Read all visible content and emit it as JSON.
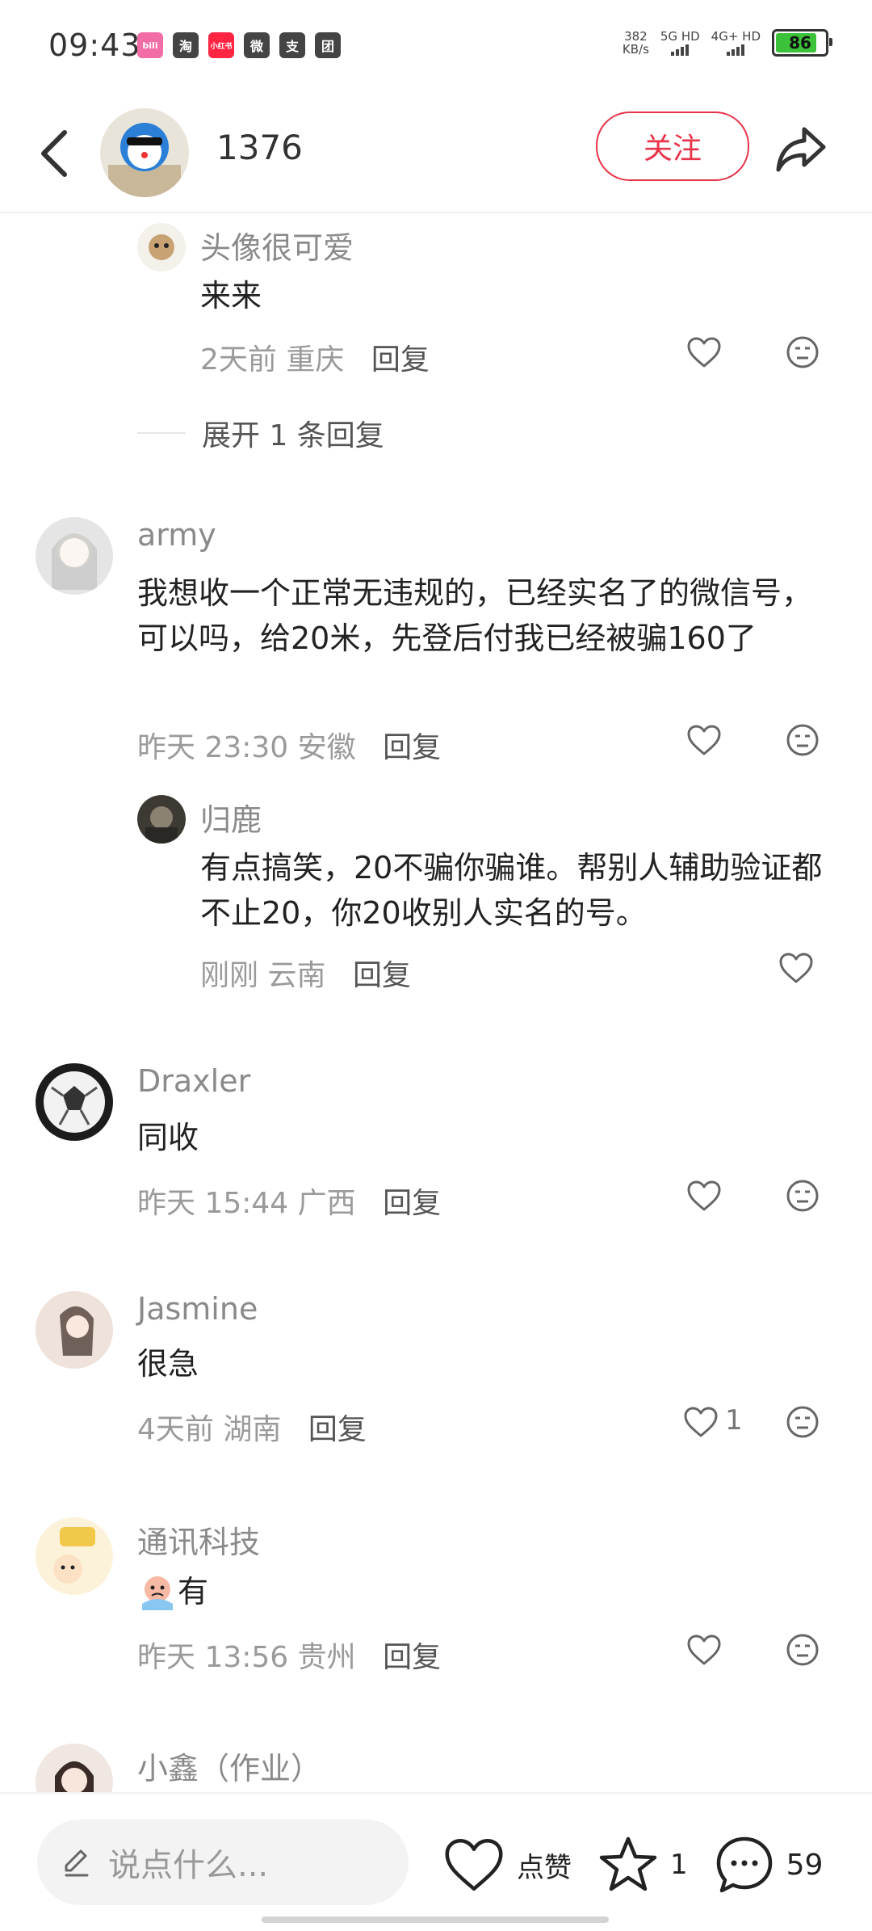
{
  "status_bar": {
    "time": "09:43",
    "app_icons": [
      "bilibili-icon",
      "taobao-icon",
      "xiaohongshu-icon",
      "wechat-icon",
      "alipay-icon",
      "meituan-icon"
    ],
    "app_icon_labels": [
      "bili",
      "淘",
      "小红书",
      "微",
      "支",
      "团"
    ],
    "net_speed": "382",
    "net_speed_unit": "KB/s",
    "sim1": "5G HD",
    "sim2": "4G+ HD",
    "battery": "86",
    "battery_level": 0.86
  },
  "header": {
    "username": "1376",
    "follow_label": "关注"
  },
  "comments": [
    {
      "user": "头像很可爱",
      "text": "来来",
      "time": "2天前",
      "location": "重庆",
      "reply": "回复",
      "expand": "展开 1 条回复"
    },
    {
      "user": "army",
      "text": "我想收一个正常无违规的，已经实名了的微信号，可以吗，给20米，先登后付我已经被骗160了",
      "time": "昨天 23:30",
      "location": "安徽",
      "reply": "回复"
    },
    {
      "user": "归鹿",
      "text": "有点搞笑，20不骗你骗谁。帮别人辅助验证都不止20，你20收别人实名的号。",
      "time": "刚刚",
      "location": "云南",
      "reply": "回复"
    },
    {
      "user": "Draxler",
      "text": "同收",
      "time": "昨天 15:44",
      "location": "广西",
      "reply": "回复"
    },
    {
      "user": "Jasmine",
      "text": "很急",
      "time": "4天前",
      "location": "湖南",
      "reply": "回复",
      "likes": "1"
    },
    {
      "user": "通讯科技",
      "text": "有",
      "time": "昨天 13:56",
      "location": "贵州",
      "reply": "回复"
    },
    {
      "user": "小鑫（作业）"
    }
  ],
  "bottom_bar": {
    "placeholder": "说点什么...",
    "like_label": "点赞",
    "star_count": "1",
    "comment_count": "59"
  },
  "colors": {
    "accent": "#e8344a",
    "battery": "#3cc13b"
  }
}
